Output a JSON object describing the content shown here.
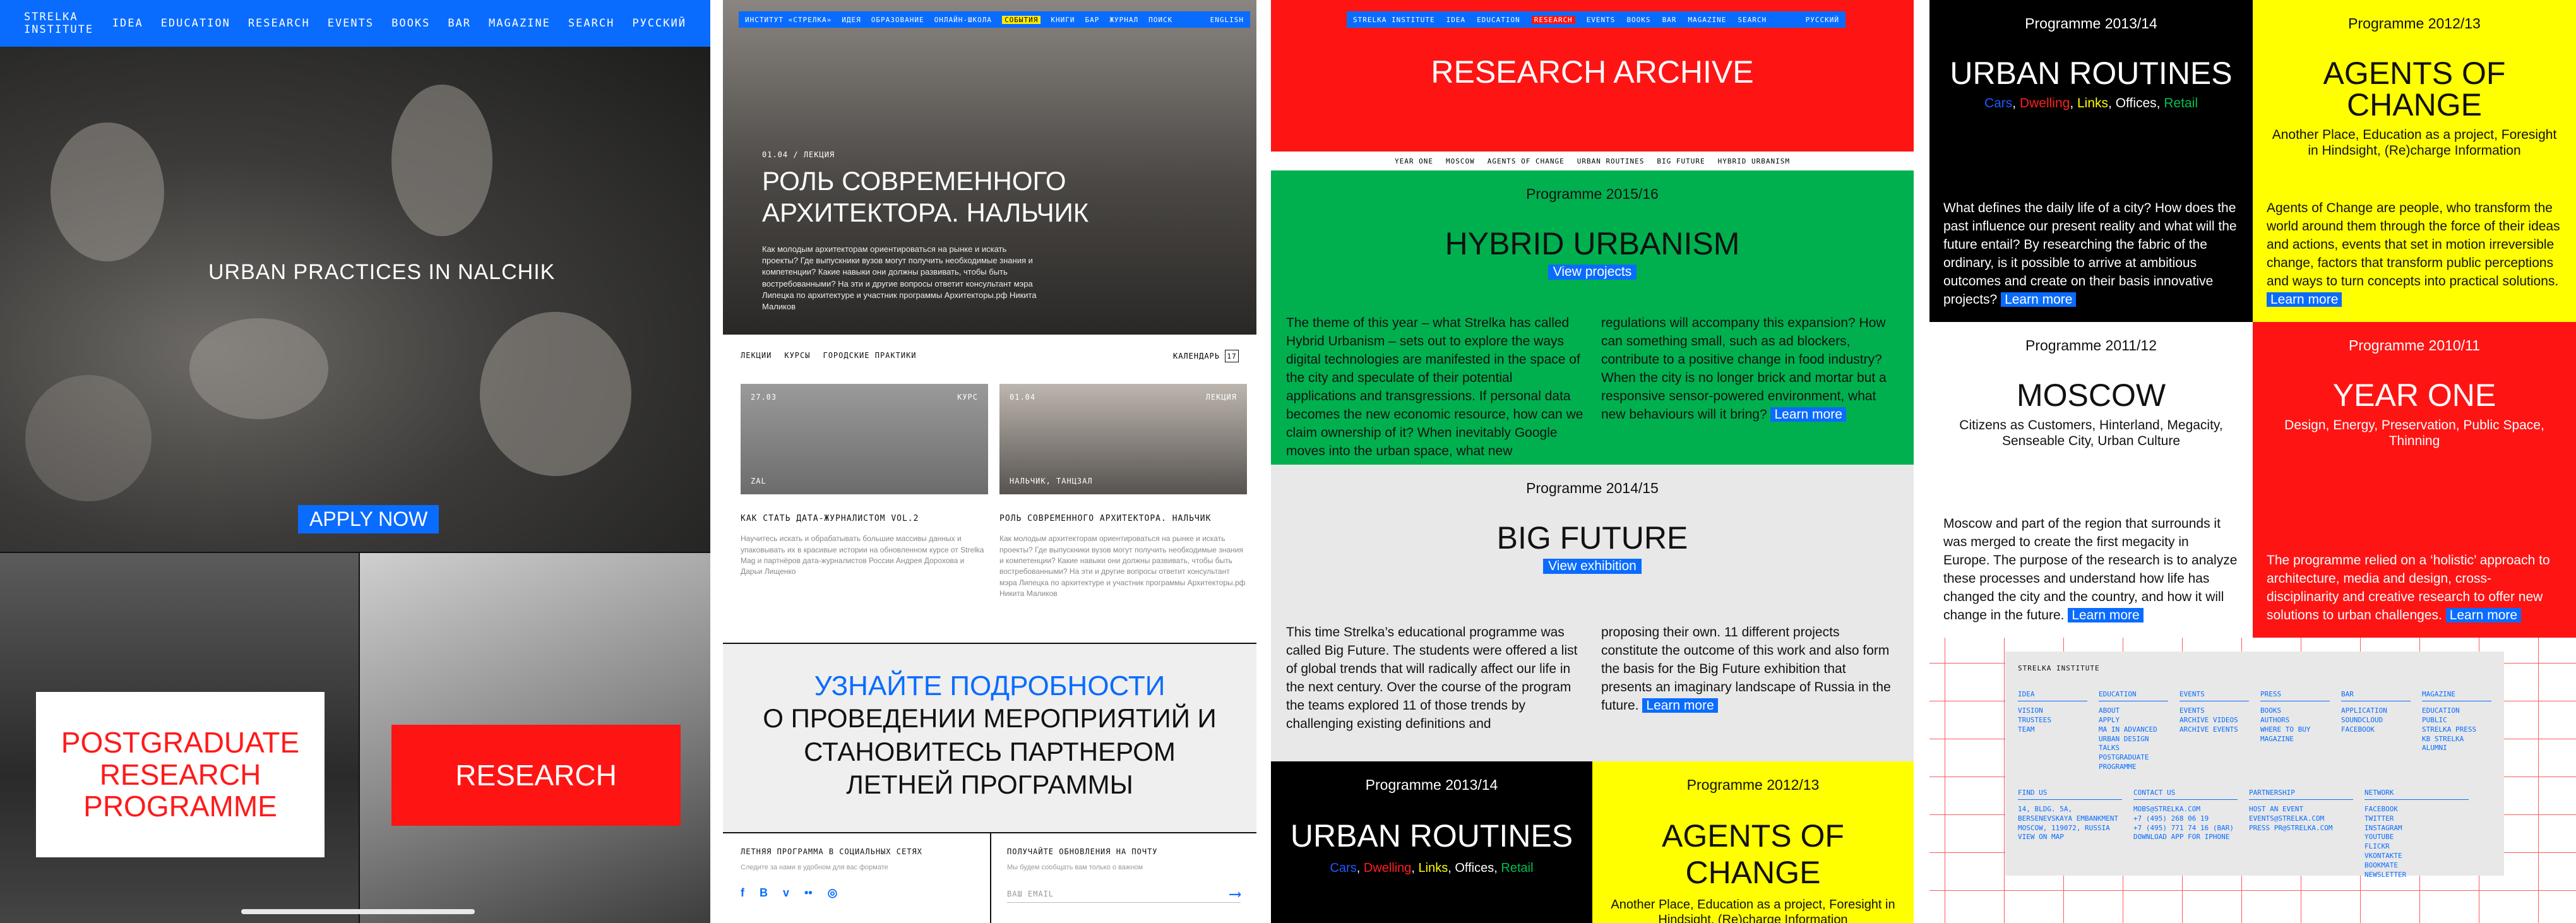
{
  "panel1": {
    "nav": [
      "STRELKA INSTITUTE",
      "IDEA",
      "EDUCATION",
      "RESEARCH",
      "EVENTS",
      "BOOKS",
      "BAR",
      "MAGAZINE",
      "SEARCH"
    ],
    "nav_right": "РУССКИЙ",
    "hero_title": "URBAN PRACTICES IN NALCHIK",
    "apply_label": "APPLY NOW",
    "postgrad_label": "POSTGRADUATE RESEARCH PROGRAMME",
    "research_label": "RESEARCH"
  },
  "panel2": {
    "nav": [
      "ИНСТИТУТ «СТРЕЛКА»",
      "ИДЕЯ",
      "ОБРАЗОВАНИЕ",
      "ОНЛАЙН-ШКОЛА",
      "СОБЫТИЯ",
      "КНИГИ",
      "БАР",
      "ЖУРНАЛ",
      "ПОИСК"
    ],
    "nav_active_index": 4,
    "nav_right": "ENGLISH",
    "meta": "01.04 / ЛЕКЦИЯ",
    "title": "РОЛЬ СОВРЕМЕННОГО АРХИТЕКТОРА. НАЛЬЧИК",
    "desc": "Как молодым архитекторам ориентироваться на рынке и искать проекты? Где выпускники вузов могут получить необходимые знания и компетенции? Какие навыки они должны развивать, чтобы быть востребованными? На эти и другие вопросы ответит консультант мэра Липецка по архитектуре и участник программы Архитекторы.рф Никита Маликов",
    "filters": [
      "ЛЕКЦИИ",
      "КУРСЫ",
      "ГОРОДСКИЕ ПРАКТИКИ"
    ],
    "calendar_label": "КАЛЕНДАРЬ",
    "calendar_day": "17",
    "cards": [
      {
        "date": "27.03",
        "type": "КУРС",
        "place": "ZAL",
        "title": "КАК СТАТЬ ДАТА-ЖУРНАЛИСТОМ VOL.2",
        "desc": "Научитесь искать и обрабатывать большие массивы данных и упаковывать их в красивые истории на обновленном курсе от Strelka Mag и партнёров дата-журналистов России Андрея Дорохова и Дарьи Лищенко"
      },
      {
        "date": "01.04",
        "type": "ЛЕКЦИЯ",
        "place": "НАЛЬЧИК, ТАНЦЗАЛ",
        "title": "РОЛЬ СОВРЕМЕННОГО АРХИТЕКТОРА. НАЛЬЧИК",
        "desc": "Как молодым архитекторам ориентироваться на рынке и искать проекты? Где выпускники вузов могут получить необходимые знания и компетенции? Какие навыки они должны развивать, чтобы быть востребованными? На эти и другие вопросы ответит консультант мэра Липецка по архитектуре и участник программы Архитекторы.рф Никита Маликов"
      }
    ],
    "cta_line1": "УЗНАЙТЕ ПОДРОБНОСТИ",
    "cta_line2": "О ПРОВЕДЕНИИ МЕРОПРИЯТИЙ И СТАНОВИТЕСЬ ПАРТНЕРОМ ЛЕТНЕЙ ПРОГРАММЫ",
    "social_head": "ЛЕТНЯЯ ПРОГРАММА В СОЦИАЛЬНЫХ СЕТЯХ",
    "social_sub": "Следите за нами в удобном для вас формате",
    "social_icons": [
      "f",
      "B",
      "v",
      "••",
      "◎"
    ],
    "subscribe_head": "ПОЛУЧАЙТЕ ОБНОВЛЕНИЯ НА ПОЧТУ",
    "subscribe_sub": "Мы будем сообщать вам только о важном",
    "email_placeholder": "ВАШ EMAIL"
  },
  "panel3": {
    "nav": [
      "STRELKA INSTITUTE",
      "IDEA",
      "EDUCATION",
      "RESEARCH",
      "EVENTS",
      "BOOKS",
      "BAR",
      "MAGAZINE",
      "SEARCH"
    ],
    "nav_active_index": 3,
    "nav_right": "РУССКИЙ",
    "title": "RESEARCH ARCHIVE",
    "subnav": [
      "YEAR ONE",
      "MOSCOW",
      "AGENTS OF CHANGE",
      "URBAN ROUTINES",
      "BIG FUTURE",
      "HYBRID URBANISM"
    ],
    "hybrid": {
      "prog": "Programme 2015/16",
      "title": "HYBRID URBANISM",
      "link": "View projects",
      "col1": "The theme of this year – what Strelka has called Hybrid Urbanism – sets out to explore the ways digital technologies are manifested in the space of the city and speculate of their potential applications and transgressions. If personal data becomes the new economic resource, how can we claim ownership of it? When inevitably Google moves into the urban space, what new",
      "col2": "regulations will accompany this expansion? How can something small, such as ad blockers, contribute to a positive change in food industry? When the city is no longer brick and mortar but a responsive sensor-powered environment, what new behaviours will it bring?",
      "learn": "Learn more"
    },
    "future": {
      "prog": "Programme 2014/15",
      "title": "BIG FUTURE",
      "link": "View exhibition",
      "col1": "This time Strelka’s educational programme was called Big Future. The students were offered a list of global trends that will radically affect our life in the next century. Over the course of the program the teams explored 11 of those trends by challenging existing definitions and",
      "col2": "proposing their own. 11 different projects constitute the outcome of this work and also form the basis for the Big Future exhibition that presents an imaginary landscape of Russia in the future.",
      "learn": "Learn more"
    },
    "routines": {
      "prog": "Programme 2013/14",
      "title": "URBAN ROUTINES",
      "tags": [
        {
          "text": "Cars",
          "color": "#1e5bff"
        },
        {
          "text": "Dwelling",
          "color": "#ff2020"
        },
        {
          "text": "Links",
          "color": "#ffff00"
        },
        {
          "text": "Offices",
          "color": "#ffffff"
        },
        {
          "text": "Retail",
          "color": "#00c050"
        }
      ]
    },
    "agents": {
      "prog": "Programme 2012/13",
      "title": "AGENTS OF CHANGE",
      "tags": "Another Place, Education as a project, Foresight in Hindsight, (Re)charge Information"
    }
  },
  "panel4": {
    "routines": {
      "prog": "Programme 2013/14",
      "title": "URBAN ROUTINES",
      "tags": [
        {
          "text": "Cars",
          "color": "#1e5bff"
        },
        {
          "text": "Dwelling",
          "color": "#ff2020"
        },
        {
          "text": "Links",
          "color": "#ffff00"
        },
        {
          "text": "Offices",
          "color": "#ffffff"
        },
        {
          "text": "Retail",
          "color": "#00c050"
        }
      ],
      "text": "What defines the daily life of a city? How does the past influence our present reality and what will the future entail? By researching the fabric of the ordinary, is it possible to arrive at ambitious outcomes and create on their basis innovative projects?",
      "learn": "Learn more"
    },
    "agents": {
      "prog": "Programme 2012/13",
      "title": "AGENTS OF CHANGE",
      "tags": "Another Place, Education as a project, Foresight in Hindsight, (Re)charge Information",
      "text": "Agents of Change are people, who transform the world around them through the force of their ideas and actions, events that set in motion irreversible change, factors that transform public perceptions and ways to turn concepts into practical solutions.",
      "learn": "Learn more"
    },
    "moscow": {
      "prog": "Programme 2011/12",
      "title": "MOSCOW",
      "tags": "Citizens as Customers, Hinterland, Megacity, Senseable City, Urban Culture",
      "text": "Moscow and part of the region that surrounds it was merged to create the first megacity in Europe. The purpose of the research is to analyze these processes and understand how life has changed the city and the country, and how it will change in the future.",
      "learn": "Learn more"
    },
    "yearone": {
      "prog": "Programme 2010/11",
      "title": "YEAR ONE",
      "tags": "Design, Energy, Preservation, Public Space, Thinning",
      "text": "The programme relied on a ‘holistic’ approach to architecture, media and design, cross-disciplinarity and creative research to offer new solutions to urban challenges.",
      "learn": "Learn more"
    },
    "footer": {
      "brand": "STRELKA INSTITUTE",
      "cols": [
        {
          "head": "IDEA",
          "items": [
            "VISION",
            "TRUSTEES",
            "TEAM"
          ]
        },
        {
          "head": "EDUCATION",
          "items": [
            "ABOUT",
            "APPLY",
            "MA IN ADVANCED",
            "URBAN DESIGN",
            "TALKS",
            "POSTGRADUATE",
            "PROGRAMME"
          ]
        },
        {
          "head": "EVENTS",
          "items": [
            "EVENTS",
            "ARCHIVE VIDEOS",
            "ARCHIVE EVENTS"
          ]
        },
        {
          "head": "PRESS",
          "items": [
            "BOOKS",
            "AUTHORS",
            "WHERE TO BUY",
            "MAGAZINE"
          ]
        },
        {
          "head": "BAR",
          "items": [
            "APPLICATION",
            "SOUNDCLOUD",
            "FACEBOOK"
          ]
        },
        {
          "head": "MAGAZINE",
          "items": [
            "EDUCATION",
            "PUBLIC",
            "STRELKA PRESS",
            "KB STRELKA",
            "ALUMNI"
          ]
        }
      ],
      "cols2": [
        {
          "head": "FIND US",
          "items": [
            "14, BLDG. 5A,",
            "BERSENEVSKAYA EMBANKMENT",
            "MOSCOW, 119072, RUSSIA",
            "VIEW ON MAP"
          ]
        },
        {
          "head": "CONTACT US",
          "items": [
            "MOBS@STRELKA.COM",
            "+7 (495) 268 06 19",
            "+7 (495) 771 74 16 (BAR)",
            "DOWNLOAD APP FOR IPHONE"
          ]
        },
        {
          "head": "PARTNERSHIP",
          "items": [
            "HOST AN EVENT",
            "EVENTS@STRELKA.COM",
            "PRESS PR@STRELKA.COM"
          ]
        },
        {
          "head": "NETWORK",
          "items": [
            "FACEBOOK",
            "TWITTER",
            "INSTAGRAM",
            "YOUTUBE",
            "FLICKR",
            "VKONTAKTE",
            "BOOKMATE",
            "NEWSLETTER"
          ]
        }
      ]
    }
  }
}
